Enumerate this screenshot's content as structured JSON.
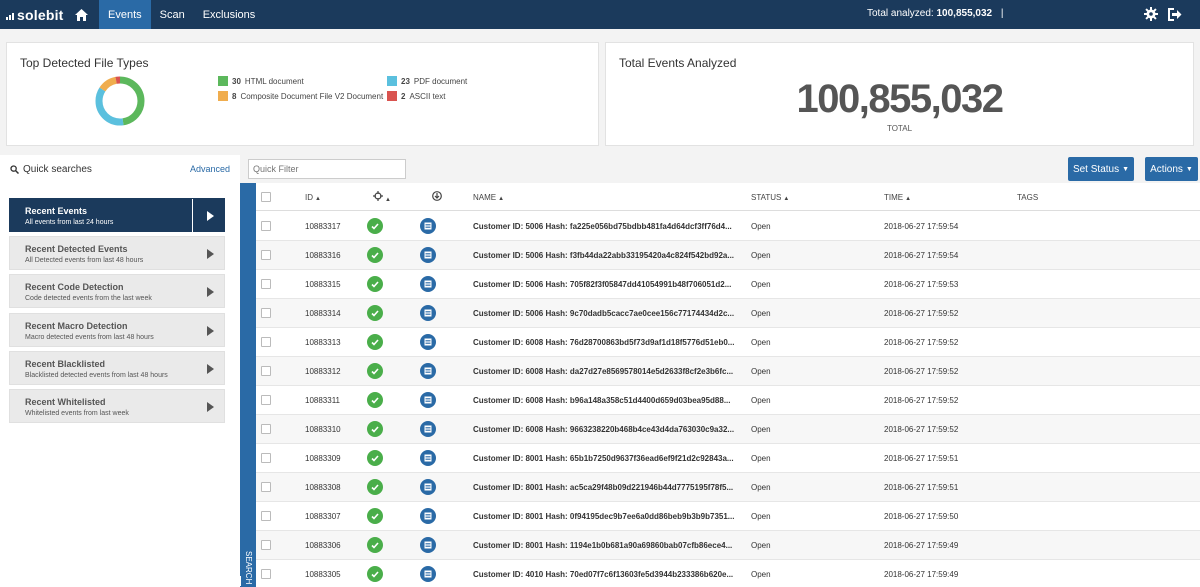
{
  "app": {
    "logo": "solebit",
    "nav_tabs": [
      "Events",
      "Scan",
      "Exclusions"
    ],
    "active_tab": "Events",
    "total_analyzed_label": "Total analyzed:",
    "total_analyzed_value": "100,855,032",
    "separator": "|"
  },
  "file_types_card": {
    "title": "Top Detected File Types",
    "legend": [
      {
        "count": "30",
        "label": "HTML document",
        "color": "#5cb85c"
      },
      {
        "count": "23",
        "label": "PDF document",
        "color": "#5bc0de"
      },
      {
        "count": "8",
        "label": "Composite Document File V2 Document",
        "color": "#f0ad4e"
      },
      {
        "count": "2",
        "label": "ASCII text",
        "color": "#d9534f"
      }
    ]
  },
  "total_card": {
    "title": "Total Events Analyzed",
    "value": "100,855,032",
    "label": "TOTAL"
  },
  "toolbar": {
    "quick_searches": "Quick searches",
    "advanced": "Advanced",
    "filter_placeholder": "Quick Filter",
    "set_status": "Set Status",
    "actions": "Actions"
  },
  "saved_searches": [
    {
      "title": "Recent Events",
      "desc": "All events from last 24 hours",
      "active": true
    },
    {
      "title": "Recent Detected Events",
      "desc": "All Detected events from last 48 hours",
      "active": false
    },
    {
      "title": "Recent Code Detection",
      "desc": "Code detected events from the last week",
      "active": false
    },
    {
      "title": "Recent Macro Detection",
      "desc": "Macro detected events from last 48 hours",
      "active": false
    },
    {
      "title": "Recent Blacklisted",
      "desc": "Blacklisted detected events from last 48 hours",
      "active": false
    },
    {
      "title": "Recent Whitelisted",
      "desc": "Whitelisted events from last week",
      "active": false
    }
  ],
  "search_tab_label": "SEARCH",
  "table": {
    "columns": {
      "id": "ID",
      "name": "NAME",
      "status": "STATUS",
      "time": "TIME",
      "tags": "TAGS"
    },
    "rows": [
      {
        "id": "10883317",
        "name": "Customer ID: 5006 Hash: fa225e056bd75bdbb481fa4d64dcf3ff76d4...",
        "status": "Open",
        "time": "2018-06-27 17:59:54"
      },
      {
        "id": "10883316",
        "name": "Customer ID: 5006 Hash: f3fb44da22abb33195420a4c824f542bd92a...",
        "status": "Open",
        "time": "2018-06-27 17:59:54"
      },
      {
        "id": "10883315",
        "name": "Customer ID: 5006 Hash: 705f82f3f05847dd41054991b48f706051d2...",
        "status": "Open",
        "time": "2018-06-27 17:59:53"
      },
      {
        "id": "10883314",
        "name": "Customer ID: 5006 Hash: 9c70dadb5cacc7ae0cee156c77174434d2c...",
        "status": "Open",
        "time": "2018-06-27 17:59:52"
      },
      {
        "id": "10883313",
        "name": "Customer ID: 6008 Hash: 76d28700863bd5f73d9af1d18f5776d51eb0...",
        "status": "Open",
        "time": "2018-06-27 17:59:52"
      },
      {
        "id": "10883312",
        "name": "Customer ID: 6008 Hash: da27d27e8569578014e5d2633f8cf2e3b6fc...",
        "status": "Open",
        "time": "2018-06-27 17:59:52"
      },
      {
        "id": "10883311",
        "name": "Customer ID: 6008 Hash: b96a148a358c51d4400d659d03bea95d88...",
        "status": "Open",
        "time": "2018-06-27 17:59:52"
      },
      {
        "id": "10883310",
        "name": "Customer ID: 6008 Hash: 9663238220b468b4ce43d4da763030c9a32...",
        "status": "Open",
        "time": "2018-06-27 17:59:52"
      },
      {
        "id": "10883309",
        "name": "Customer ID: 8001 Hash: 65b1b7250d9637f36ead6ef9f21d2c92843a...",
        "status": "Open",
        "time": "2018-06-27 17:59:51"
      },
      {
        "id": "10883308",
        "name": "Customer ID: 8001 Hash: ac5ca29f48b09d221946b44d7775195f78f5...",
        "status": "Open",
        "time": "2018-06-27 17:59:51"
      },
      {
        "id": "10883307",
        "name": "Customer ID: 8001 Hash: 0f94195dec9b7ee6a0dd86beb9b3b9b7351...",
        "status": "Open",
        "time": "2018-06-27 17:59:50"
      },
      {
        "id": "10883306",
        "name": "Customer ID: 8001 Hash: 1194e1b0b681a90a69860bab07cfb86ece4...",
        "status": "Open",
        "time": "2018-06-27 17:59:49"
      },
      {
        "id": "10883305",
        "name": "Customer ID: 4010 Hash: 70ed07f7c6f13603fe5d3944b233386b620e...",
        "status": "Open",
        "time": "2018-06-27 17:59:49"
      }
    ]
  }
}
